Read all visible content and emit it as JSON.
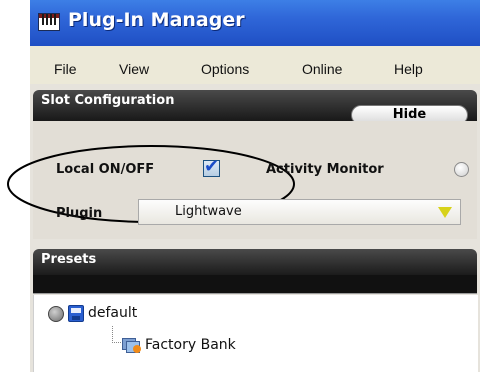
{
  "window": {
    "title": "Plug-In Manager"
  },
  "menu": {
    "items": [
      "File",
      "View",
      "Options",
      "Online",
      "Help"
    ]
  },
  "slot_configuration": {
    "header": "Slot Configuration",
    "hide_label": "Hide",
    "local_label": "Local ON/OFF",
    "local_checked": true,
    "activity_label": "Activity Monitor",
    "plugin_label": "Plugin",
    "plugin_value": "Lightwave"
  },
  "presets": {
    "header": "Presets",
    "items": [
      {
        "label": "default",
        "icon": "disk-icon"
      },
      {
        "label": "Factory Bank",
        "icon": "bank-folder-icon"
      }
    ]
  },
  "colors": {
    "titlebar": "#2f66d8",
    "section_header": "#141414",
    "arrow": "#d7d21a",
    "checkmark": "#1a4cc8"
  }
}
